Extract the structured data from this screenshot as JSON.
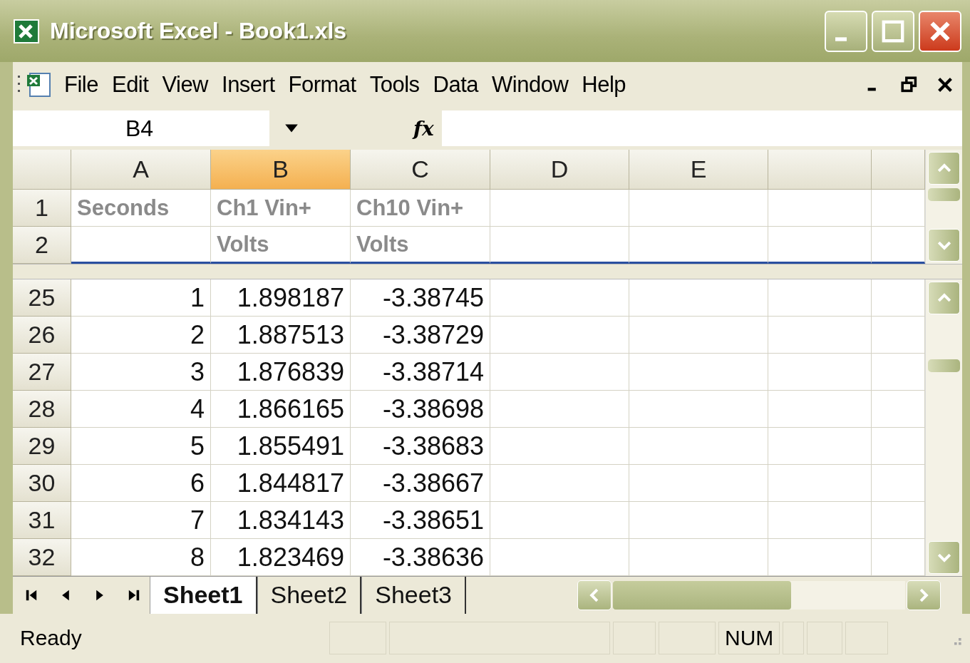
{
  "window": {
    "title": "Microsoft Excel - Book1.xls"
  },
  "menu": [
    "File",
    "Edit",
    "View",
    "Insert",
    "Format",
    "Tools",
    "Data",
    "Window",
    "Help"
  ],
  "formula_bar": {
    "name_box": "B4",
    "fx_label": "fx"
  },
  "columns": [
    {
      "label": "A",
      "selected": false
    },
    {
      "label": "B",
      "selected": true
    },
    {
      "label": "C",
      "selected": false
    },
    {
      "label": "D",
      "selected": false
    },
    {
      "label": "E",
      "selected": false
    }
  ],
  "frozen_rows": [
    {
      "header": "1",
      "kind": "label",
      "cells": [
        "Seconds",
        "Ch1 Vin+",
        "Ch10 Vin+"
      ]
    },
    {
      "header": "2",
      "kind": "label",
      "cells": [
        "",
        "Volts",
        "Volts"
      ]
    }
  ],
  "rows": [
    {
      "header": "25",
      "kind": "number",
      "cells": [
        "1",
        "1.898187",
        "-3.38745"
      ]
    },
    {
      "header": "26",
      "kind": "number",
      "cells": [
        "2",
        "1.887513",
        "-3.38729"
      ]
    },
    {
      "header": "27",
      "kind": "number",
      "cells": [
        "3",
        "1.876839",
        "-3.38714"
      ]
    },
    {
      "header": "28",
      "kind": "number",
      "cells": [
        "4",
        "1.866165",
        "-3.38698"
      ]
    },
    {
      "header": "29",
      "kind": "number",
      "cells": [
        "5",
        "1.855491",
        "-3.38683"
      ]
    },
    {
      "header": "30",
      "kind": "number",
      "cells": [
        "6",
        "1.844817",
        "-3.38667"
      ]
    },
    {
      "header": "31",
      "kind": "number",
      "cells": [
        "7",
        "1.834143",
        "-3.38651"
      ]
    },
    {
      "header": "32",
      "kind": "number",
      "cells": [
        "8",
        "1.823469",
        "-3.38636"
      ]
    }
  ],
  "sheet_tabs": [
    {
      "label": "Sheet1",
      "selected": true
    },
    {
      "label": "Sheet2",
      "selected": false
    },
    {
      "label": "Sheet3",
      "selected": false
    }
  ],
  "status_bar": {
    "text": "Ready",
    "num": "NUM"
  }
}
